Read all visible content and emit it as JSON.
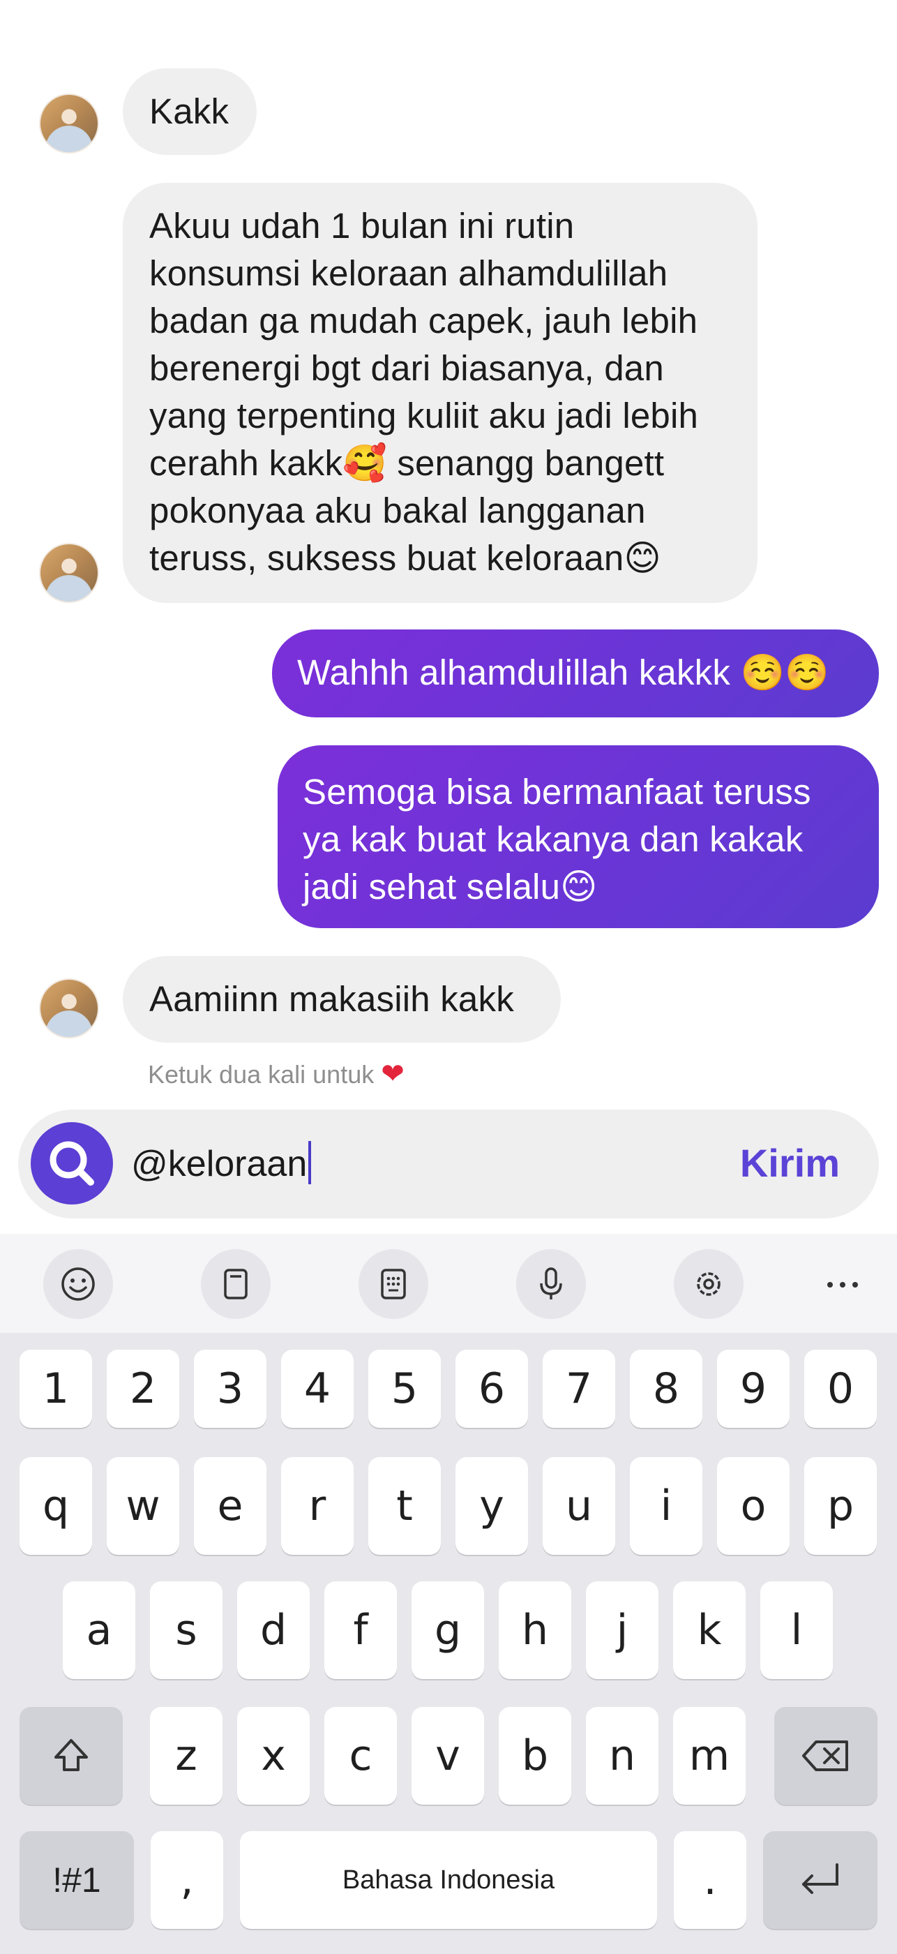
{
  "messages": [
    {
      "side": "in",
      "text": "Kakk"
    },
    {
      "side": "in",
      "lines": [
        "Akuu udah 1 bulan ini rutin",
        "konsumsi keloraan alhamdulillah",
        "badan ga mudah capek, jauh lebih",
        "berenergi bgt dari biasanya, dan",
        "yang terpenting kuliit aku jadi lebih",
        "cerahh kakk🥰 senangg bangett",
        "pokonyaa aku bakal langganan",
        "teruss, suksess buat keloraan😊"
      ]
    },
    {
      "side": "out",
      "text": "Wahhh alhamdulillah kakkk ☺️☺️"
    },
    {
      "side": "out",
      "lines": [
        "Semoga bisa bermanfaat teruss",
        "ya kak buat kakanya dan kakak",
        "jadi sehat selalu😊"
      ]
    },
    {
      "side": "in",
      "text": "Aamiinn makasiih kakk"
    }
  ],
  "hint": {
    "text": "Ketuk dua kali untuk",
    "icon": "heart-icon",
    "color": "#e3243b"
  },
  "composer": {
    "value": "@keloraan",
    "send_label": "Kirim",
    "accent": "#5c3fd4"
  },
  "keyboard": {
    "toolbar": [
      "emoji-icon",
      "clipboard-icon",
      "keypad-icon",
      "microphone-icon",
      "gear-icon",
      "more-icon"
    ],
    "numbers": [
      "1",
      "2",
      "3",
      "4",
      "5",
      "6",
      "7",
      "8",
      "9",
      "0"
    ],
    "row1": [
      "q",
      "w",
      "e",
      "r",
      "t",
      "y",
      "u",
      "i",
      "o",
      "p"
    ],
    "row2": [
      "a",
      "s",
      "d",
      "f",
      "g",
      "h",
      "j",
      "k",
      "l"
    ],
    "row3": [
      "z",
      "x",
      "c",
      "v",
      "b",
      "n",
      "m"
    ],
    "symbols_label": "!#1",
    "comma": ",",
    "space_label": "Bahasa Indonesia",
    "period": "."
  }
}
